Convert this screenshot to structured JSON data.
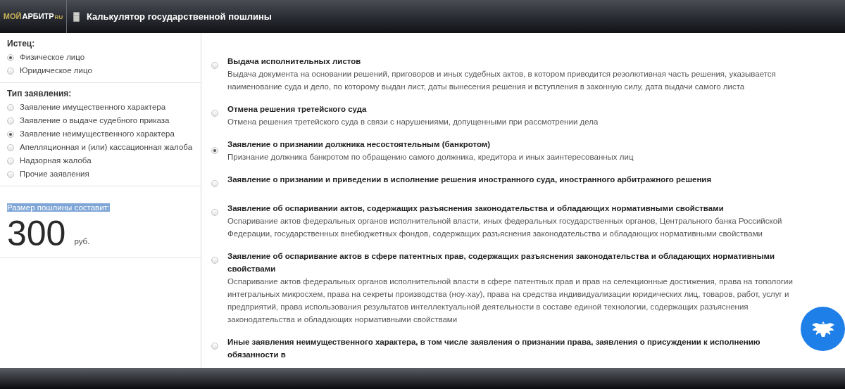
{
  "header": {
    "logo": {
      "part_1": "МОЙ",
      "part_2": "АРБИТР",
      "suffix": "RU"
    },
    "title": "Калькулятор государственной пошлины"
  },
  "sidebar": {
    "groups": [
      {
        "label": "Истец:",
        "options": [
          {
            "label": "Физическое лицо",
            "selected": true
          },
          {
            "label": "Юридическое лицо",
            "selected": false
          }
        ]
      },
      {
        "label": "Тип заявления:",
        "options": [
          {
            "label": "Заявление имущественного характера",
            "selected": false
          },
          {
            "label": "Заявление о выдаче судебного приказа",
            "selected": false
          },
          {
            "label": "Заявление неимущественного характера",
            "selected": true
          },
          {
            "label": "Апелляционная и (или) кассационная жалоба",
            "selected": false
          },
          {
            "label": "Надзорная жалоба",
            "selected": false
          },
          {
            "label": "Прочие заявления",
            "selected": false
          }
        ]
      }
    ],
    "result": {
      "label": "Размер пошлины составит:",
      "highlighted": true,
      "amount": "300",
      "currency": "руб."
    }
  },
  "content": {
    "options": [
      {
        "title": "Выдача исполнительных листов",
        "description": "Выдача документа на основании решений, приговоров и иных судебных актов, в котором приводится резолютивная часть решения, указывается наименование суда и дело, по которому выдан лист, даты вынесения решения и вступления в законную силу, дата выдачи самого листа",
        "selected": false
      },
      {
        "title": "Отмена решения третейского суда",
        "description": "Отмена решения третейского суда в связи с нарушениями, допущенными при рассмотрении дела",
        "selected": false
      },
      {
        "title": "Заявление о признании должника несостоятельным (банкротом)",
        "description": "Признание должника банкротом по обращению самого должника, кредитора и иных заинтересованных лиц",
        "selected": true
      },
      {
        "title": "Заявление о признании и приведении в исполнение решения иностранного суда, иностранного арбитражного решения",
        "selected": false
      },
      {
        "title": "Заявление об оспаривании актов, содержащих разъяснения законодательства и обладающих нормативными свойствами",
        "description": "Оспаривание актов федеральных органов исполнительной власти, иных федеральных государственных органов, Центрального банка Российской Федерации, государственных внебюджетных фондов, содержащих разъяснения законодательства и обладающих нормативными свойствами",
        "selected": false
      },
      {
        "title": "Заявление об оспаривание актов в сфере патентных прав, содержащих разъяснения законодательства и обладающих нормативными свойствами",
        "description": "Оспаривание актов федеральных органов исполнительной власти в сфере патентных прав и прав на селекционные достижения, права на топологии интегральных микросхем, права на секреты производства (ноу-хау), права на средства индивидуализации юридических лиц, товаров, работ, услуг и предприятий, права использования результатов интеллектуальной деятельности в составе единой технологии, содержащих разъяснения законодательства и обладающих нормативными свойствами",
        "selected": false
      },
      {
        "title": "Иные заявления неимущественного характера, в том числе заявления о признании права, заявления о присуждении к исполнению обязанности в",
        "selected": false
      }
    ]
  }
}
